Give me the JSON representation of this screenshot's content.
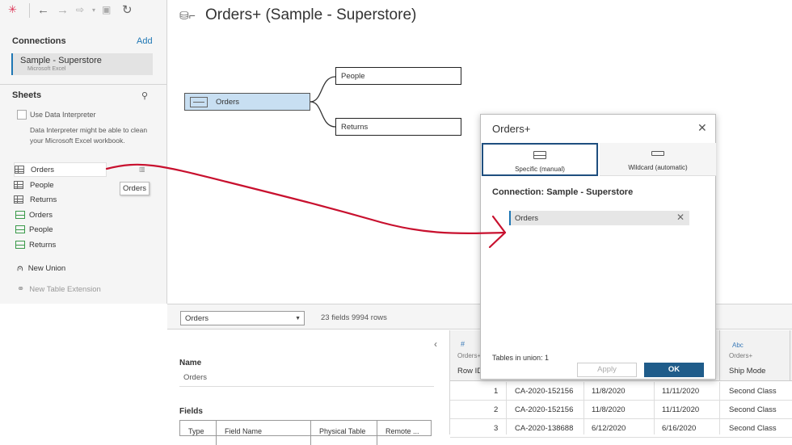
{
  "connections": {
    "title": "Connections",
    "add": "Add",
    "item": {
      "name": "Sample - Superstore",
      "type": "Microsoft Excel"
    }
  },
  "sheets": {
    "title": "Sheets",
    "interpreter_label": "Use Data Interpreter",
    "interpreter_desc": "Data Interpreter might be able to clean your Microsoft Excel workbook.",
    "items": [
      {
        "label": "Orders",
        "kind": "sheet"
      },
      {
        "label": "People",
        "kind": "sheet"
      },
      {
        "label": "Returns",
        "kind": "sheet"
      },
      {
        "label": "Orders",
        "kind": "named-range"
      },
      {
        "label": "People",
        "kind": "named-range"
      },
      {
        "label": "Returns",
        "kind": "named-range"
      }
    ],
    "tooltip": "Orders",
    "new_union": "New Union",
    "new_table_extension": "New Table Extension"
  },
  "canvas": {
    "title": "Orders+ (Sample - Superstore)",
    "tables": {
      "orders": "Orders",
      "people": "People",
      "returns": "Returns"
    }
  },
  "bottombar": {
    "selected_table": "Orders",
    "field_info": "23 fields 9994 rows"
  },
  "metadata": {
    "name_label": "Name",
    "name_value": "Orders",
    "fields_label": "Fields",
    "columns": [
      "Type",
      "Field Name",
      "Physical Table",
      "Remote ..."
    ]
  },
  "grid": {
    "headers": [
      {
        "type": "#",
        "source": "Orders+",
        "name": "Row ID"
      },
      {
        "type": "Abc",
        "source": "Orders+",
        "name": "Ship Mode"
      }
    ],
    "rows": [
      {
        "n": "1",
        "order": "CA-2020-152156",
        "date": "11/8/2020",
        "ship": "11/11/2020",
        "mode": "Second Class"
      },
      {
        "n": "2",
        "order": "CA-2020-152156",
        "date": "11/8/2020",
        "ship": "11/11/2020",
        "mode": "Second Class"
      },
      {
        "n": "3",
        "order": "CA-2020-138688",
        "date": "6/12/2020",
        "ship": "6/16/2020",
        "mode": "Second Class"
      }
    ]
  },
  "dialog": {
    "title": "Orders+",
    "tab_specific": "Specific (manual)",
    "tab_wildcard": "Wildcard (automatic)",
    "connection": "Connection: Sample - Superstore",
    "union_table": "Orders",
    "tables_in_union": "Tables in union: 1",
    "apply": "Apply",
    "ok": "OK"
  },
  "colors": {
    "accent": "#1f77b4",
    "ok_button": "#1f5c8a",
    "annotation": "#c8102e",
    "selected_table": "#c8dff2"
  }
}
